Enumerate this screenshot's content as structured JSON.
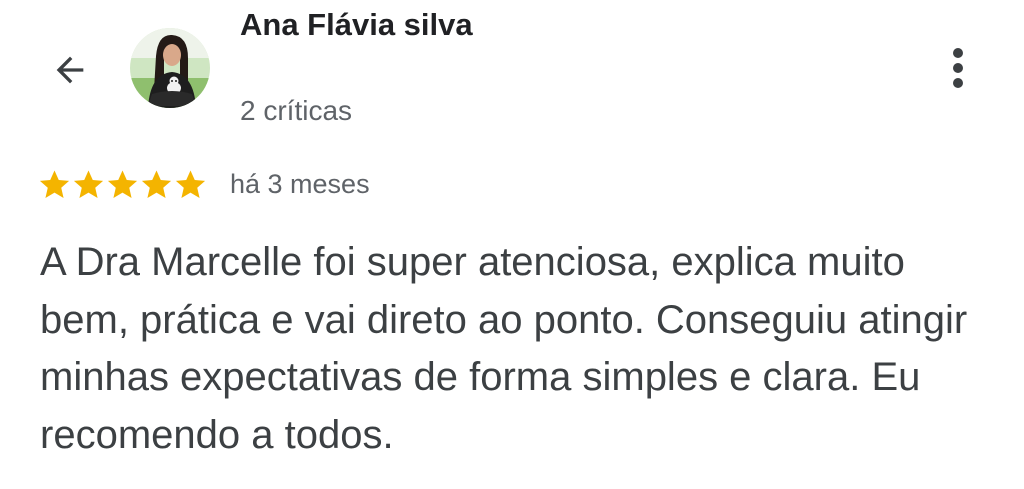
{
  "header": {
    "back_icon": "arrow-back-icon",
    "menu_icon": "more-vert-icon",
    "reviewer_name": "Ana Flávia silva",
    "review_count": "2 críticas"
  },
  "review": {
    "rating": 5,
    "max_rating": 5,
    "star_color": "#f4b400",
    "date": "há 3 meses",
    "text": "A Dra Marcelle foi super atenciosa, explica muito bem, prática e vai direto ao ponto. Conseguiu atingir minhas expectativas de forma simples e clara. Eu recomendo a todos."
  }
}
